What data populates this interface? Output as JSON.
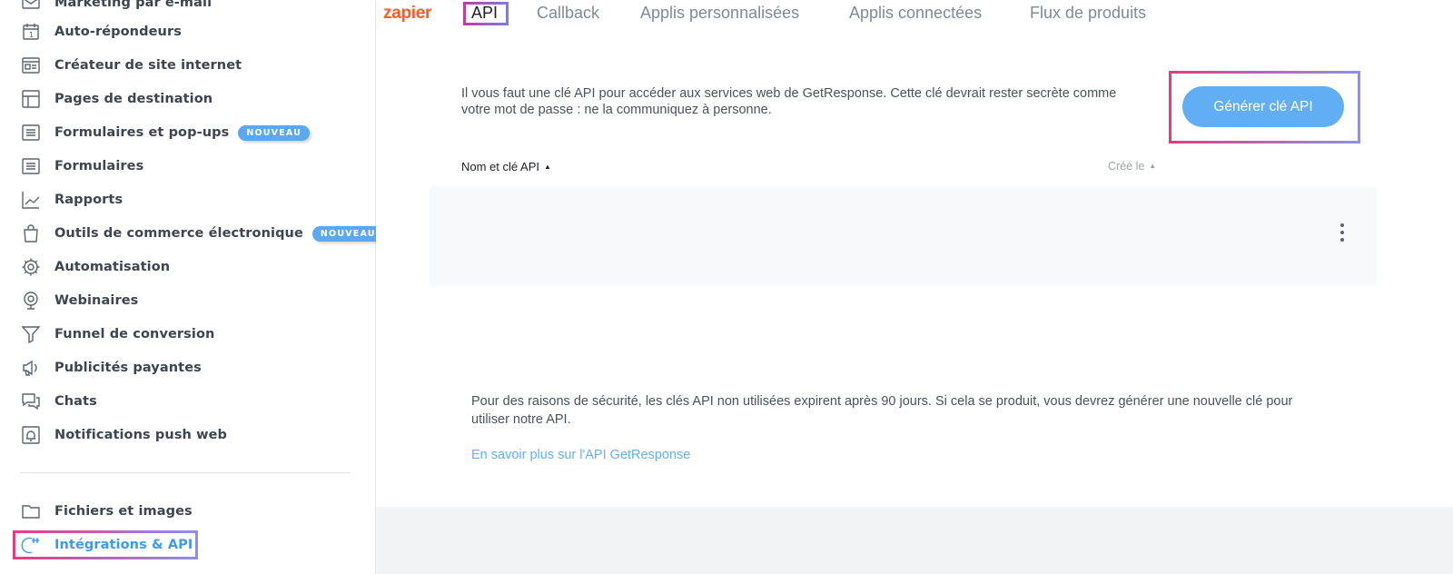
{
  "sidebar": {
    "items": [
      {
        "label": "Marketing par e-mail",
        "icon": "email-icon"
      },
      {
        "label": "Auto-répondeurs",
        "icon": "calendar-icon"
      },
      {
        "label": "Créateur de site internet",
        "icon": "website-icon"
      },
      {
        "label": "Pages de destination",
        "icon": "layout-icon"
      },
      {
        "label": "Formulaires et pop-ups",
        "icon": "form-icon",
        "badge": "NOUVEAU"
      },
      {
        "label": "Formulaires",
        "icon": "form-icon"
      },
      {
        "label": "Rapports",
        "icon": "chart-icon"
      },
      {
        "label": "Outils de commerce électronique",
        "icon": "shopping-bag-icon",
        "badge": "NOUVEAU"
      },
      {
        "label": "Automatisation",
        "icon": "gear-icon"
      },
      {
        "label": "Webinaires",
        "icon": "webcam-icon"
      },
      {
        "label": "Funnel de conversion",
        "icon": "funnel-icon"
      },
      {
        "label": "Publicités payantes",
        "icon": "megaphone-icon"
      },
      {
        "label": "Chats",
        "icon": "chat-icon"
      },
      {
        "label": "Notifications push web",
        "icon": "bell-icon"
      }
    ],
    "bottom_items": [
      {
        "label": "Fichiers et images",
        "icon": "folder-icon"
      },
      {
        "label": "Intégrations & API",
        "icon": "plug-icon",
        "active": true
      }
    ]
  },
  "tabs": [
    {
      "label": "zapier",
      "kind": "logo"
    },
    {
      "label": "API",
      "active": true
    },
    {
      "label": "Callback"
    },
    {
      "label": "Applis personnalisées"
    },
    {
      "label": "Applis connectées"
    },
    {
      "label": "Flux de produits"
    }
  ],
  "api": {
    "intro_text": "Il vous faut une clé API pour accéder aux services web de GetResponse. Cette clé devrait rester secrète comme votre mot de passe : ne la communiquez à personne.",
    "generate_button": "Générer clé API",
    "col_name": "Nom et clé API",
    "col_created": "Créé le",
    "security_note": "Pour des raisons de sécurité, les clés API non utilisées expirent après 90 jours. Si cela se produit, vous devrez générer une nouvelle clé pour utiliser notre API.",
    "learn_more": "En savoir plus sur l'API GetResponse"
  },
  "colors": {
    "accent": "#61aef4",
    "zapier": "#ff5a1f",
    "highlight_start": "#e83a7f",
    "highlight_end": "#8c8ef0"
  }
}
